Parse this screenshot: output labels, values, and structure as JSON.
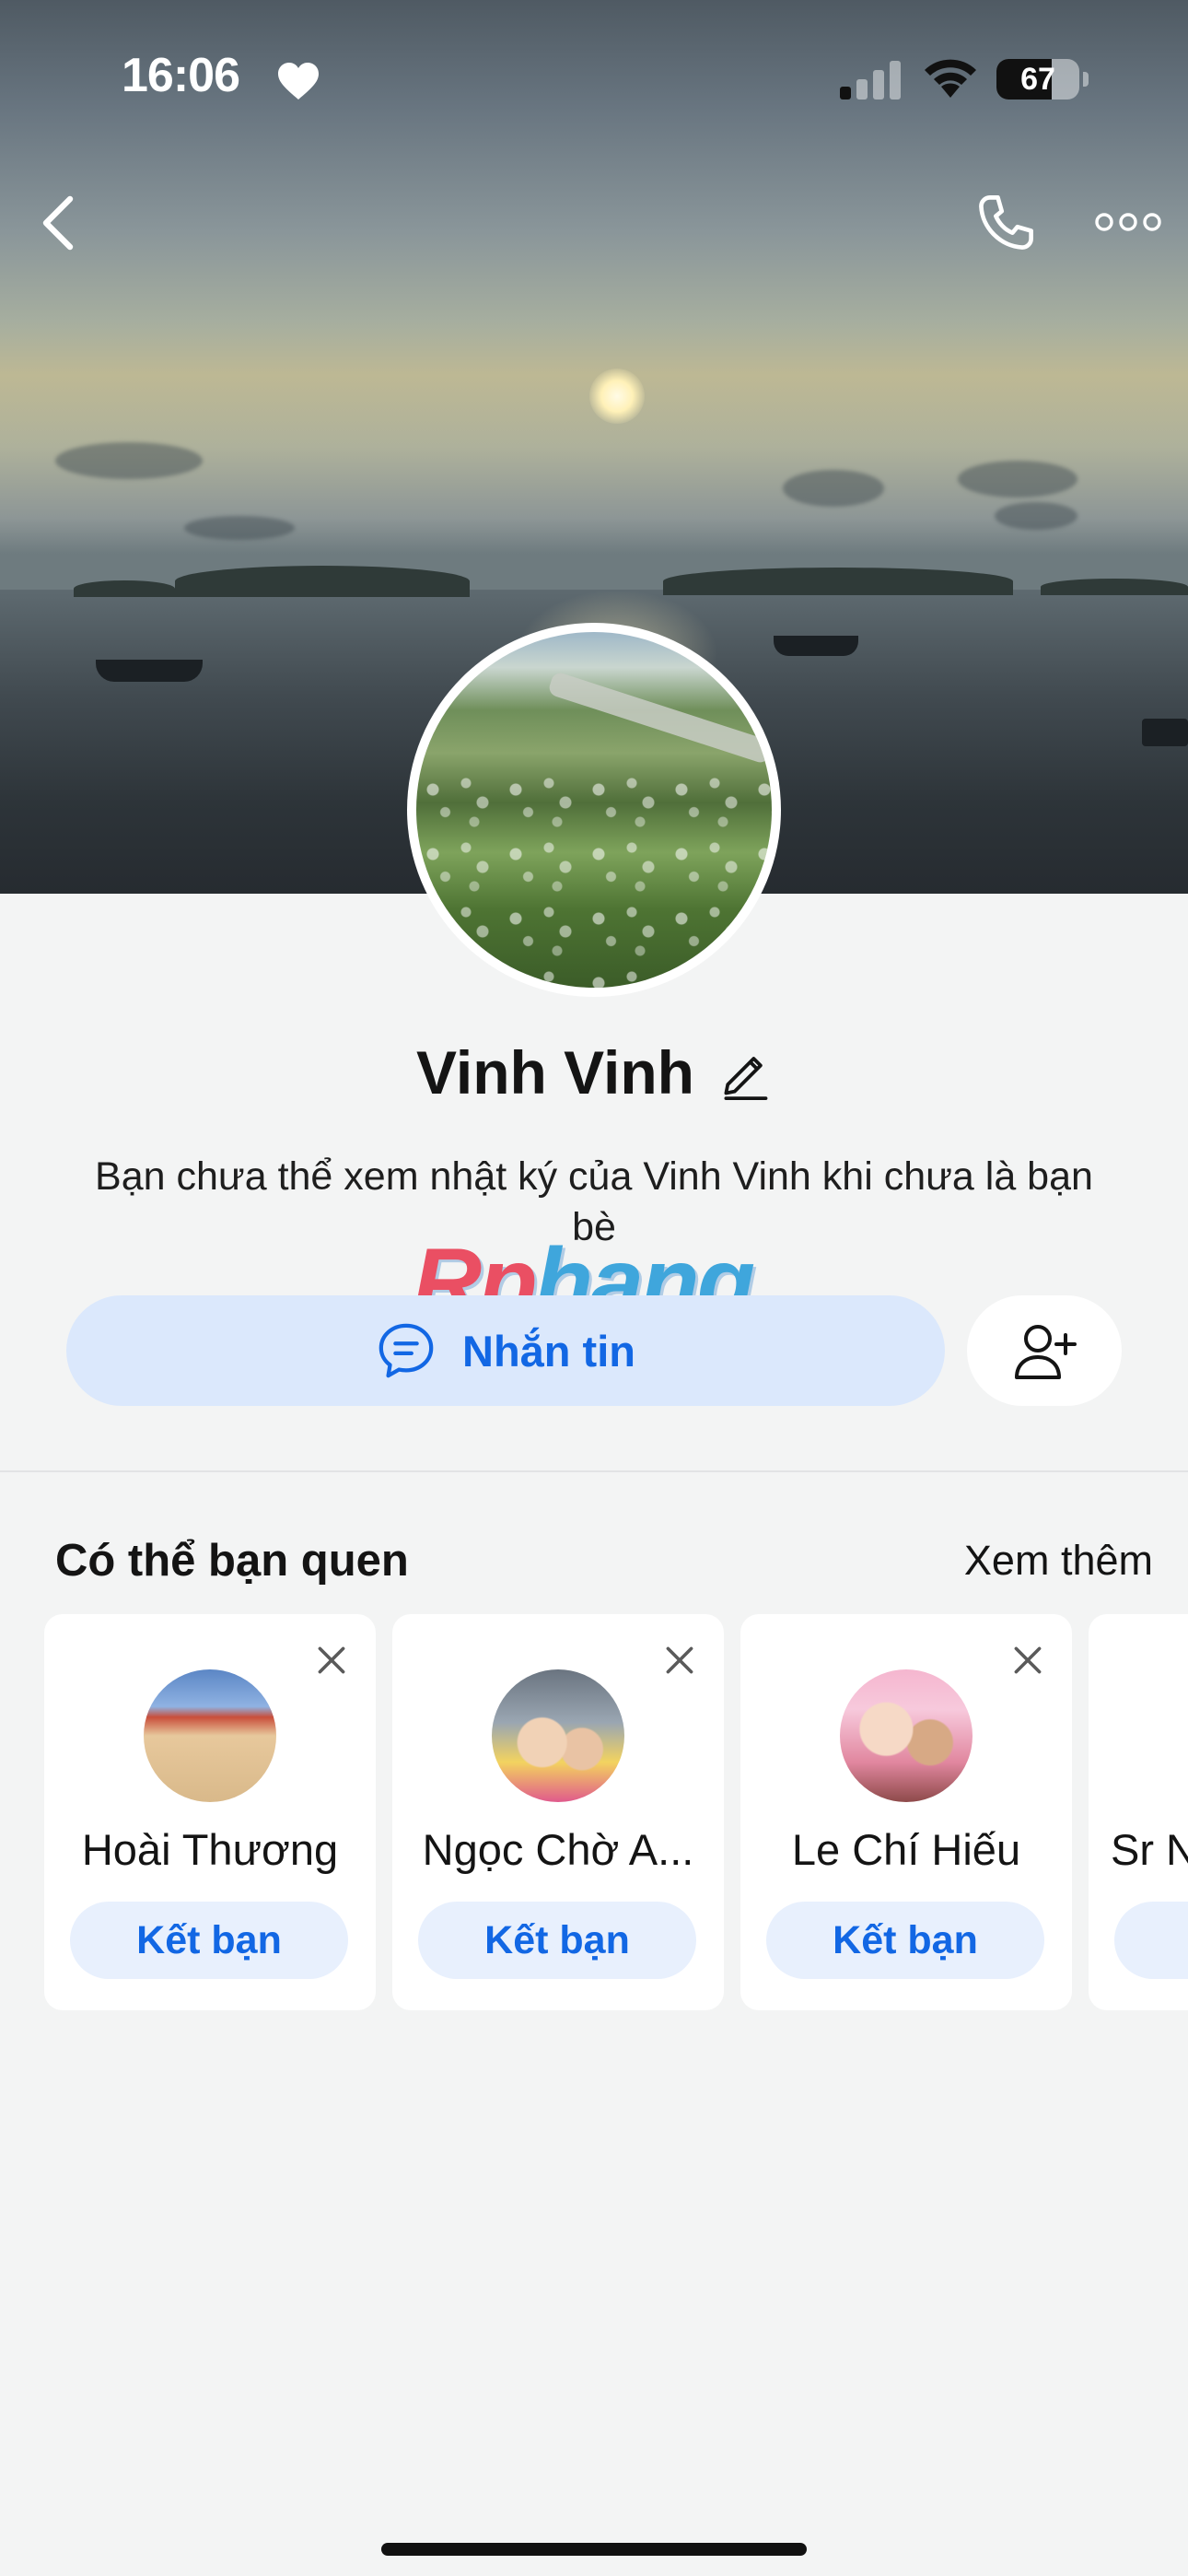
{
  "status_bar": {
    "time": "16:06",
    "battery": "67",
    "battery_level": 0.67
  },
  "nav": {
    "back_icon": "chevron-left-icon",
    "call_icon": "phone-icon",
    "more_icon": "more-horizontal-icon"
  },
  "profile": {
    "name": "Vinh Vinh",
    "privacy_note": "Bạn chưa thể xem nhật ký của Vinh Vinh khi chưa là bạn bè"
  },
  "watermark": {
    "text_a": "Rp",
    "text_b": "hang"
  },
  "actions": {
    "message_label": "Nhắn tin"
  },
  "suggestions": {
    "title": "Có thể bạn quen",
    "see_more": "Xem thêm",
    "add_label": "Kết bạn",
    "people": [
      {
        "name": "Hoài Thương"
      },
      {
        "name": "Ngọc Chờ A..."
      },
      {
        "name": "Le Chí Hiếu"
      },
      {
        "name": "Sr N"
      }
    ]
  },
  "colors": {
    "accent": "#1267e4",
    "button_bg": "#dbe8fc",
    "page_bg": "#f3f4f4"
  }
}
